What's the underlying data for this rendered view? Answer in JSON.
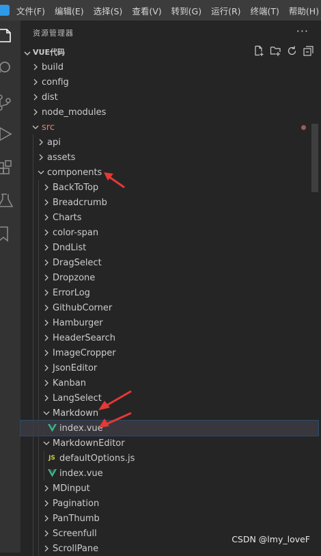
{
  "menubar": {
    "items": [
      "文件(F)",
      "编辑(E)",
      "选择(S)",
      "查看(V)",
      "转到(G)",
      "运行(R)",
      "终端(T)",
      "帮助(H)"
    ]
  },
  "sidebar": {
    "header": "资源管理器",
    "more": "···",
    "section_title": "VUE代码",
    "section_actions": [
      "new-file-icon",
      "new-folder-icon",
      "refresh-icon",
      "collapse-all-icon"
    ]
  },
  "tree": [
    {
      "label": "build",
      "type": "folder",
      "expanded": false,
      "depth": 0
    },
    {
      "label": "config",
      "type": "folder",
      "expanded": false,
      "depth": 0
    },
    {
      "label": "dist",
      "type": "folder",
      "expanded": false,
      "depth": 0
    },
    {
      "label": "node_modules",
      "type": "folder",
      "expanded": false,
      "depth": 0
    },
    {
      "label": "src",
      "type": "folder",
      "expanded": true,
      "depth": 0,
      "modified": true
    },
    {
      "label": "api",
      "type": "folder",
      "expanded": false,
      "depth": 1
    },
    {
      "label": "assets",
      "type": "folder",
      "expanded": false,
      "depth": 1
    },
    {
      "label": "components",
      "type": "folder",
      "expanded": true,
      "depth": 1
    },
    {
      "label": "BackToTop",
      "type": "folder",
      "expanded": false,
      "depth": 2
    },
    {
      "label": "Breadcrumb",
      "type": "folder",
      "expanded": false,
      "depth": 2
    },
    {
      "label": "Charts",
      "type": "folder",
      "expanded": false,
      "depth": 2
    },
    {
      "label": "color-span",
      "type": "folder",
      "expanded": false,
      "depth": 2
    },
    {
      "label": "DndList",
      "type": "folder",
      "expanded": false,
      "depth": 2
    },
    {
      "label": "DragSelect",
      "type": "folder",
      "expanded": false,
      "depth": 2
    },
    {
      "label": "Dropzone",
      "type": "folder",
      "expanded": false,
      "depth": 2
    },
    {
      "label": "ErrorLog",
      "type": "folder",
      "expanded": false,
      "depth": 2
    },
    {
      "label": "GithubCorner",
      "type": "folder",
      "expanded": false,
      "depth": 2
    },
    {
      "label": "Hamburger",
      "type": "folder",
      "expanded": false,
      "depth": 2
    },
    {
      "label": "HeaderSearch",
      "type": "folder",
      "expanded": false,
      "depth": 2
    },
    {
      "label": "ImageCropper",
      "type": "folder",
      "expanded": false,
      "depth": 2
    },
    {
      "label": "JsonEditor",
      "type": "folder",
      "expanded": false,
      "depth": 2
    },
    {
      "label": "Kanban",
      "type": "folder",
      "expanded": false,
      "depth": 2
    },
    {
      "label": "LangSelect",
      "type": "folder",
      "expanded": false,
      "depth": 2
    },
    {
      "label": "Markdown",
      "type": "folder",
      "expanded": true,
      "depth": 2
    },
    {
      "label": "index.vue",
      "type": "vue",
      "depth": 3,
      "selected": true
    },
    {
      "label": "MarkdownEditor",
      "type": "folder",
      "expanded": true,
      "depth": 2
    },
    {
      "label": "defaultOptions.js",
      "type": "js",
      "depth": 3
    },
    {
      "label": "index.vue",
      "type": "vue",
      "depth": 3
    },
    {
      "label": "MDinput",
      "type": "folder",
      "expanded": false,
      "depth": 2
    },
    {
      "label": "Pagination",
      "type": "folder",
      "expanded": false,
      "depth": 2
    },
    {
      "label": "PanThumb",
      "type": "folder",
      "expanded": false,
      "depth": 2
    },
    {
      "label": "Screenfull",
      "type": "folder",
      "expanded": false,
      "depth": 2
    },
    {
      "label": "ScrollPane",
      "type": "folder",
      "expanded": false,
      "depth": 2
    }
  ],
  "icons": {
    "js_badge": "JS"
  },
  "colors": {
    "vue_green": "#41b883",
    "vue_dark": "#35495e",
    "annotation_red": "#e53935",
    "modified_dot": "#a45a52"
  },
  "watermark": "CSDN @lmy_loveF"
}
